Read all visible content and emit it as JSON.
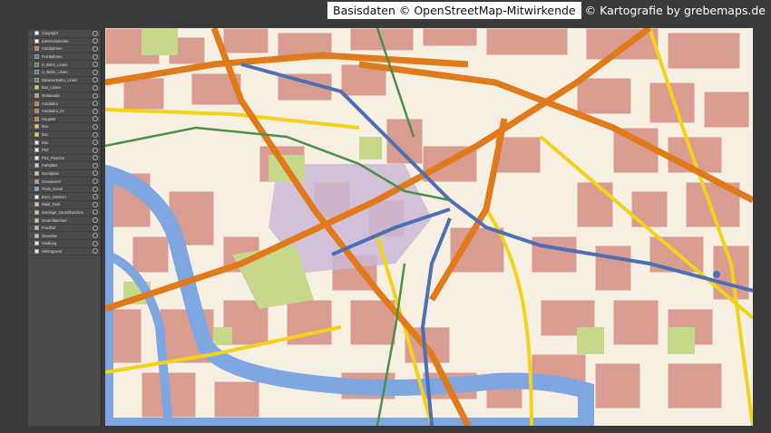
{
  "credits": {
    "data_source": "Basisdaten © OpenStreetMap-Mitwirkende",
    "cartography": "© Kartografie by grebemaps.de"
  },
  "colors": {
    "building": "#d89c90",
    "background": "#f7efe2",
    "water": "#7ea6e0",
    "park": "#c6d98a",
    "main_road": "#e07a1a",
    "secondary_road": "#f2d21a",
    "rail": "#4c6fb5",
    "tram": "#4a8f4a",
    "plaza": "#cbb9d6"
  },
  "layers": [
    {
      "name": "Copyright",
      "color": "#ffffff",
      "icon": "layer-swatch"
    },
    {
      "name": "Kartenelemente",
      "color": "#ffffff",
      "icon": "layer-swatch"
    },
    {
      "name": "Autobahnen",
      "color": "#e07a1a",
      "icon": "layer-swatch"
    },
    {
      "name": "Fernbahnen",
      "color": "#4c6fb5",
      "icon": "layer-swatch"
    },
    {
      "name": "S_Bahn_Linien",
      "color": "#4a8f4a",
      "icon": "layer-swatch"
    },
    {
      "name": "U_Bahn_Linien",
      "color": "#4c6fb5",
      "icon": "layer-swatch"
    },
    {
      "name": "Strassenbahn_Linien",
      "color": "#4a8f4a",
      "icon": "layer-swatch"
    },
    {
      "name": "Bus_Linien",
      "color": "#f2d21a",
      "icon": "layer-swatch"
    },
    {
      "name": "Gebaeude",
      "color": "#d89c90",
      "icon": "layer-swatch"
    },
    {
      "name": "Autobahn",
      "color": "#e07a1a",
      "icon": "layer-swatch"
    },
    {
      "name": "Autobahn_int",
      "color": "#e07a1a",
      "icon": "layer-swatch"
    },
    {
      "name": "Hauptstr",
      "color": "#e07a1a",
      "icon": "layer-swatch"
    },
    {
      "name": "B1x",
      "color": "#f2d21a",
      "icon": "layer-swatch"
    },
    {
      "name": "B2x",
      "color": "#f2d21a",
      "icon": "layer-swatch"
    },
    {
      "name": "B3x",
      "color": "#ffffff",
      "icon": "layer-swatch"
    },
    {
      "name": "P0Z",
      "color": "#ffffff",
      "icon": "layer-swatch"
    },
    {
      "name": "P0Z_Flaeche",
      "color": "#f7efe2",
      "icon": "layer-swatch"
    },
    {
      "name": "Parkplatz",
      "color": "#cccccc",
      "icon": "layer-swatch"
    },
    {
      "name": "Sportplatz",
      "color": "#c6d98a",
      "icon": "layer-swatch"
    },
    {
      "name": "Gewaesser",
      "color": "#7ea6e0",
      "icon": "layer-swatch"
    },
    {
      "name": "Fluss_Kanal",
      "color": "#7ea6e0",
      "icon": "layer-swatch"
    },
    {
      "name": "Buch_Strahen",
      "color": "#ffffff",
      "icon": "layer-swatch"
    },
    {
      "name": "Wald_Park",
      "color": "#c6d98a",
      "icon": "layer-swatch"
    },
    {
      "name": "Sonstige_Gruenflaechen",
      "color": "#c6d98a",
      "icon": "layer-swatch"
    },
    {
      "name": "Gruenflaechen",
      "color": "#c6d98a",
      "icon": "layer-swatch"
    },
    {
      "name": "Friedhof",
      "color": "#b5c98a",
      "icon": "layer-swatch"
    },
    {
      "name": "Gewerbe",
      "color": "#cbb9d6",
      "icon": "layer-swatch"
    },
    {
      "name": "Siedlung",
      "color": "#f7efe2",
      "icon": "layer-swatch"
    },
    {
      "name": "Hintergrund",
      "color": "#f7efe2",
      "icon": "layer-swatch"
    }
  ]
}
